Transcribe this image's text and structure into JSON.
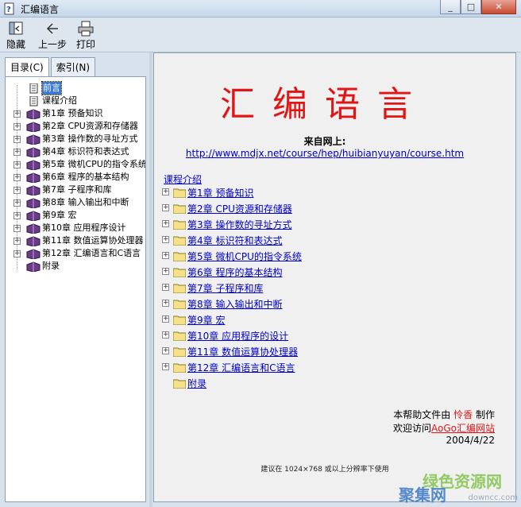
{
  "window": {
    "title": "汇编语言"
  },
  "toolbar": {
    "hide": "隐藏",
    "back": "上一步",
    "print": "打印"
  },
  "tabs": {
    "contents": "目录(C)",
    "index": "索引(N)"
  },
  "tree": [
    {
      "label": "前言",
      "type": "page",
      "selected": true,
      "expandable": false
    },
    {
      "label": "课程介绍",
      "type": "page",
      "selected": false,
      "expandable": false
    },
    {
      "label": "第1章  预备知识",
      "type": "book",
      "expandable": true
    },
    {
      "label": "第2章  CPU资源和存储器",
      "type": "book",
      "expandable": true
    },
    {
      "label": "第3章  操作数的寻址方式",
      "type": "book",
      "expandable": true
    },
    {
      "label": "第4章  标识符和表达式",
      "type": "book",
      "expandable": true
    },
    {
      "label": "第5章  微机CPU的指令系统",
      "type": "book",
      "expandable": true
    },
    {
      "label": "第6章  程序的基本结构",
      "type": "book",
      "expandable": true
    },
    {
      "label": "第7章  子程序和库",
      "type": "book",
      "expandable": true
    },
    {
      "label": "第8章  输入输出和中断",
      "type": "book",
      "expandable": true
    },
    {
      "label": "第9章  宏",
      "type": "book",
      "expandable": true
    },
    {
      "label": "第10章  应用程序设计",
      "type": "book",
      "expandable": true
    },
    {
      "label": "第11章  数值运算协处理器",
      "type": "book",
      "expandable": true
    },
    {
      "label": "第12章  汇编语言和C语言",
      "type": "book",
      "expandable": true
    },
    {
      "label": "附录",
      "type": "book",
      "expandable": false
    }
  ],
  "content": {
    "title": "汇编语言",
    "from_label": "来自网上:",
    "url": "http://www.mdjx.net/course/hep/huibianyuyan/course.htm",
    "intro": "课程介绍",
    "toc": [
      {
        "label": "第1章  预备知识",
        "expandable": true
      },
      {
        "label": "第2章  CPU资源和存储器",
        "expandable": true
      },
      {
        "label": "第3章  操作数的寻址方式",
        "expandable": true
      },
      {
        "label": "第4章  标识符和表达式",
        "expandable": true
      },
      {
        "label": "第5章  微机CPU的指令系统",
        "expandable": true
      },
      {
        "label": "第6章  程序的基本结构",
        "expandable": true
      },
      {
        "label": "第7章  子程序和库",
        "expandable": true
      },
      {
        "label": "第8章  输入输出和中断",
        "expandable": true
      },
      {
        "label": "第9章  宏",
        "expandable": true
      },
      {
        "label": "第10章  应用程序的设计",
        "expandable": true
      },
      {
        "label": "第11章  数值运算协处理器",
        "expandable": true
      },
      {
        "label": "第12章  汇编语言和C语言",
        "expandable": true
      },
      {
        "label": "附录",
        "expandable": false
      }
    ],
    "credit_prefix": "本帮助文件由",
    "credit_author": "怜香",
    "credit_suffix": "制作",
    "visit_prefix": "欢迎访问",
    "visit_site": "AoGo汇编网站",
    "date": "2004/4/22",
    "suggest": "建议在 1024×768 或以上分辨率下使用"
  },
  "watermark": {
    "line1": "绿色资源网",
    "line2": "聚集网",
    "line3": "downcc.com"
  },
  "colors": {
    "title_red": "#e01616",
    "link_blue": "#0000cc",
    "selection": "#3a7ad6"
  }
}
